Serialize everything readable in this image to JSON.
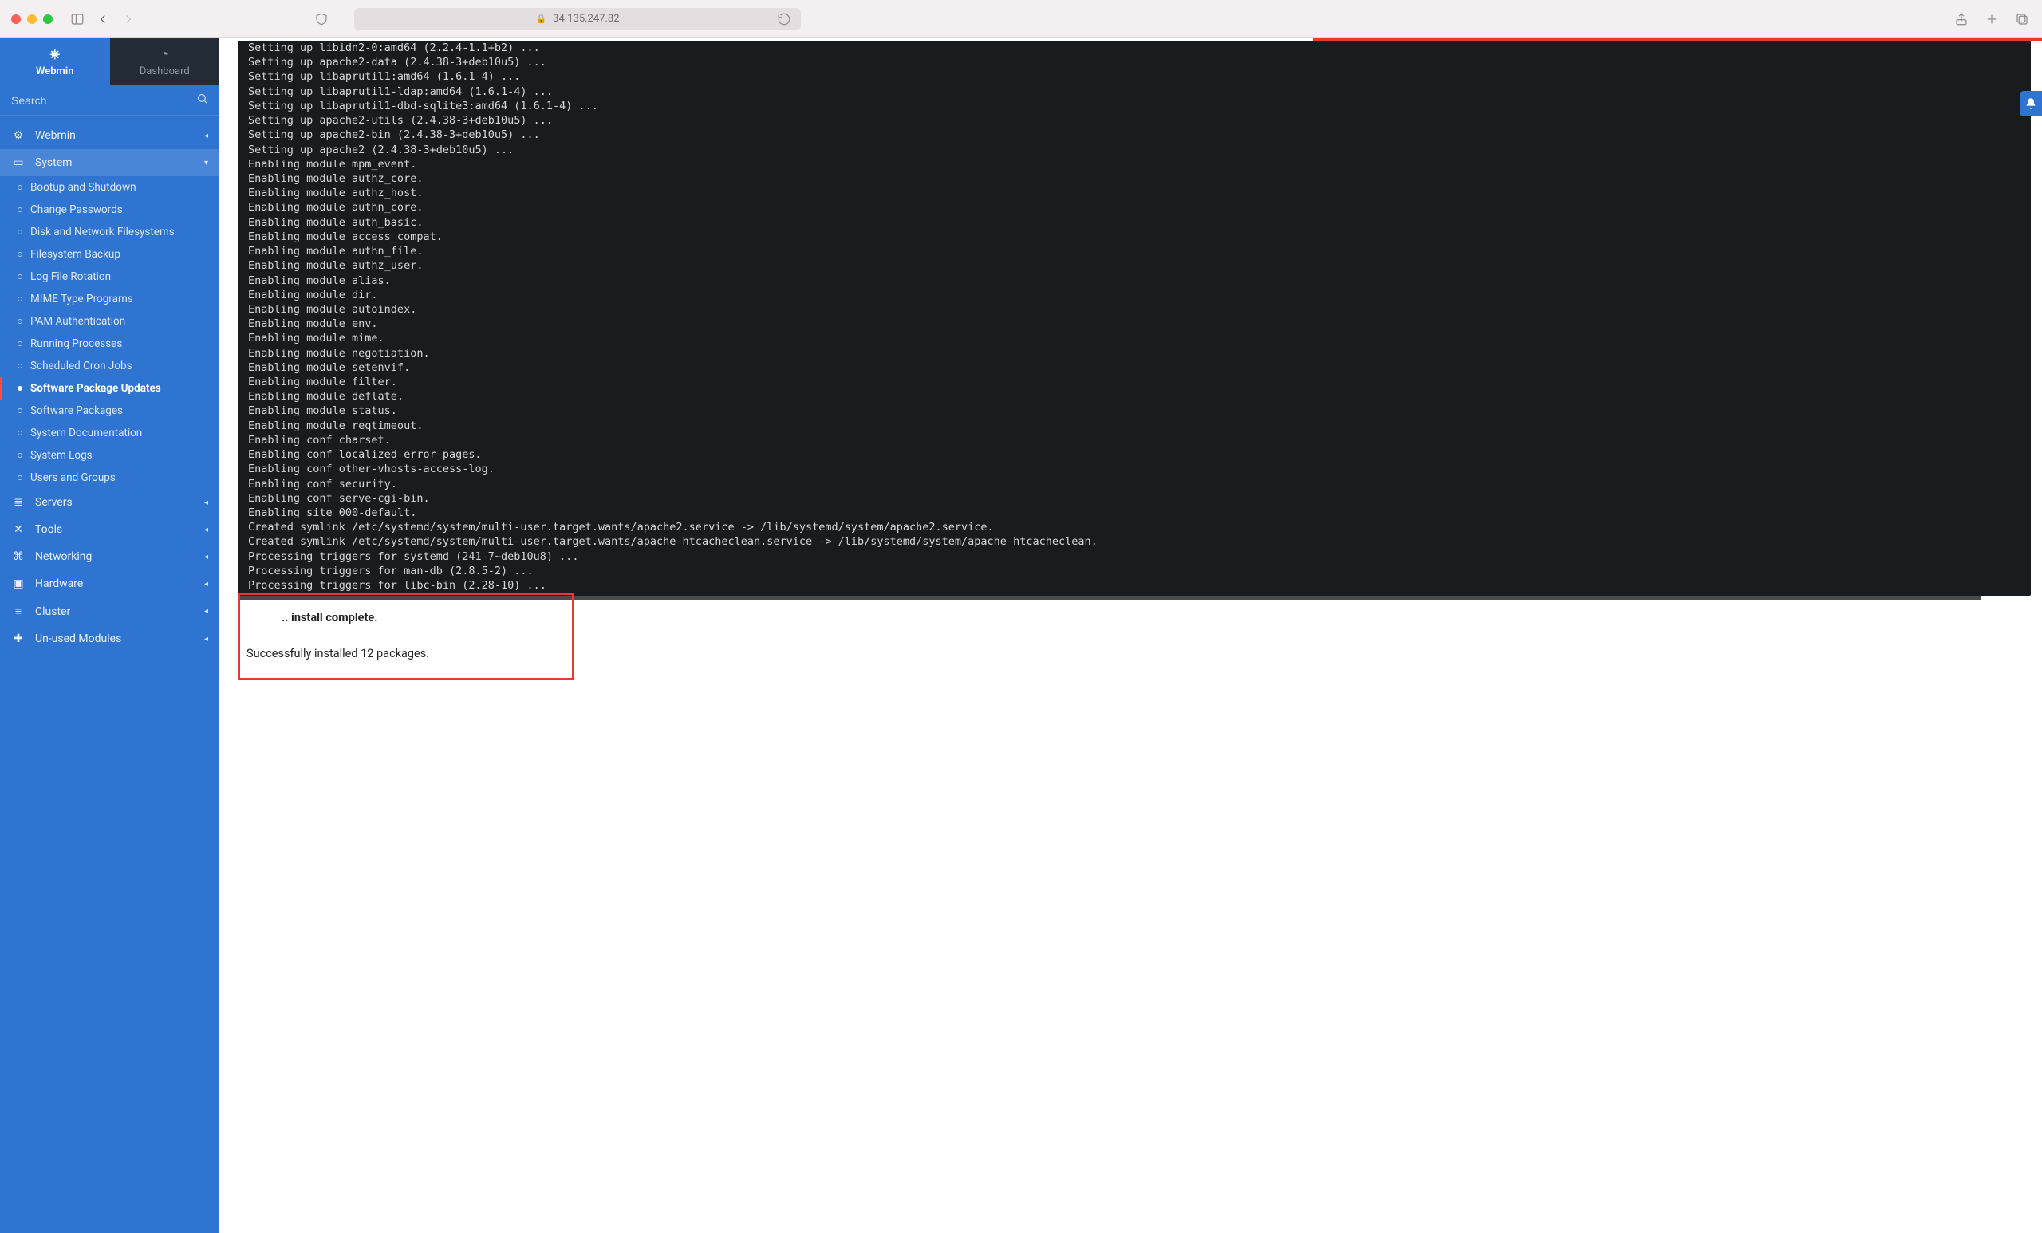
{
  "browser": {
    "url_host": "34.135.247.82"
  },
  "sidebar": {
    "tabs": {
      "webmin": "Webmin",
      "dashboard": "Dashboard"
    },
    "search_placeholder": "Search",
    "categories": [
      {
        "key": "webmin",
        "label": "Webmin",
        "icon": "⚙"
      },
      {
        "key": "system",
        "label": "System",
        "icon": "▭",
        "open": true
      },
      {
        "key": "servers",
        "label": "Servers",
        "icon": "≣"
      },
      {
        "key": "tools",
        "label": "Tools",
        "icon": "✕"
      },
      {
        "key": "networking",
        "label": "Networking",
        "icon": "⌘"
      },
      {
        "key": "hardware",
        "label": "Hardware",
        "icon": "▣"
      },
      {
        "key": "cluster",
        "label": "Cluster",
        "icon": "≡"
      },
      {
        "key": "unused",
        "label": "Un-used Modules",
        "icon": "✚"
      }
    ],
    "system_items": [
      "Bootup and Shutdown",
      "Change Passwords",
      "Disk and Network Filesystems",
      "Filesystem Backup",
      "Log File Rotation",
      "MIME Type Programs",
      "PAM Authentication",
      "Running Processes",
      "Scheduled Cron Jobs",
      "Software Package Updates",
      "Software Packages",
      "System Documentation",
      "System Logs",
      "Users and Groups"
    ],
    "system_active": "Software Package Updates"
  },
  "terminal_lines": [
    "Setting up libidn2-0:amd64 (2.2.4-1.1+b2) ...",
    "Setting up apache2-data (2.4.38-3+deb10u5) ...",
    "Setting up libaprutil1:amd64 (1.6.1-4) ...",
    "Setting up libaprutil1-ldap:amd64 (1.6.1-4) ...",
    "Setting up libaprutil1-dbd-sqlite3:amd64 (1.6.1-4) ...",
    "Setting up apache2-utils (2.4.38-3+deb10u5) ...",
    "Setting up apache2-bin (2.4.38-3+deb10u5) ...",
    "Setting up apache2 (2.4.38-3+deb10u5) ...",
    "Enabling module mpm_event.",
    "Enabling module authz_core.",
    "Enabling module authz_host.",
    "Enabling module authn_core.",
    "Enabling module auth_basic.",
    "Enabling module access_compat.",
    "Enabling module authn_file.",
    "Enabling module authz_user.",
    "Enabling module alias.",
    "Enabling module dir.",
    "Enabling module autoindex.",
    "Enabling module env.",
    "Enabling module mime.",
    "Enabling module negotiation.",
    "Enabling module setenvif.",
    "Enabling module filter.",
    "Enabling module deflate.",
    "Enabling module status.",
    "Enabling module reqtimeout.",
    "Enabling conf charset.",
    "Enabling conf localized-error-pages.",
    "Enabling conf other-vhosts-access-log.",
    "Enabling conf security.",
    "Enabling conf serve-cgi-bin.",
    "Enabling site 000-default.",
    "Created symlink /etc/systemd/system/multi-user.target.wants/apache2.service -> /lib/systemd/system/apache2.service.",
    "Created symlink /etc/systemd/system/multi-user.target.wants/apache-htcacheclean.service -> /lib/systemd/system/apache-htcacheclean.",
    "Processing triggers for systemd (241-7~deb10u8) ...",
    "Processing triggers for man-db (2.8.5-2) ...",
    "Processing triggers for libc-bin (2.28-10) ..."
  ],
  "status": {
    "install_complete": ".. install complete.",
    "success_message": "Successfully installed 12 packages."
  }
}
